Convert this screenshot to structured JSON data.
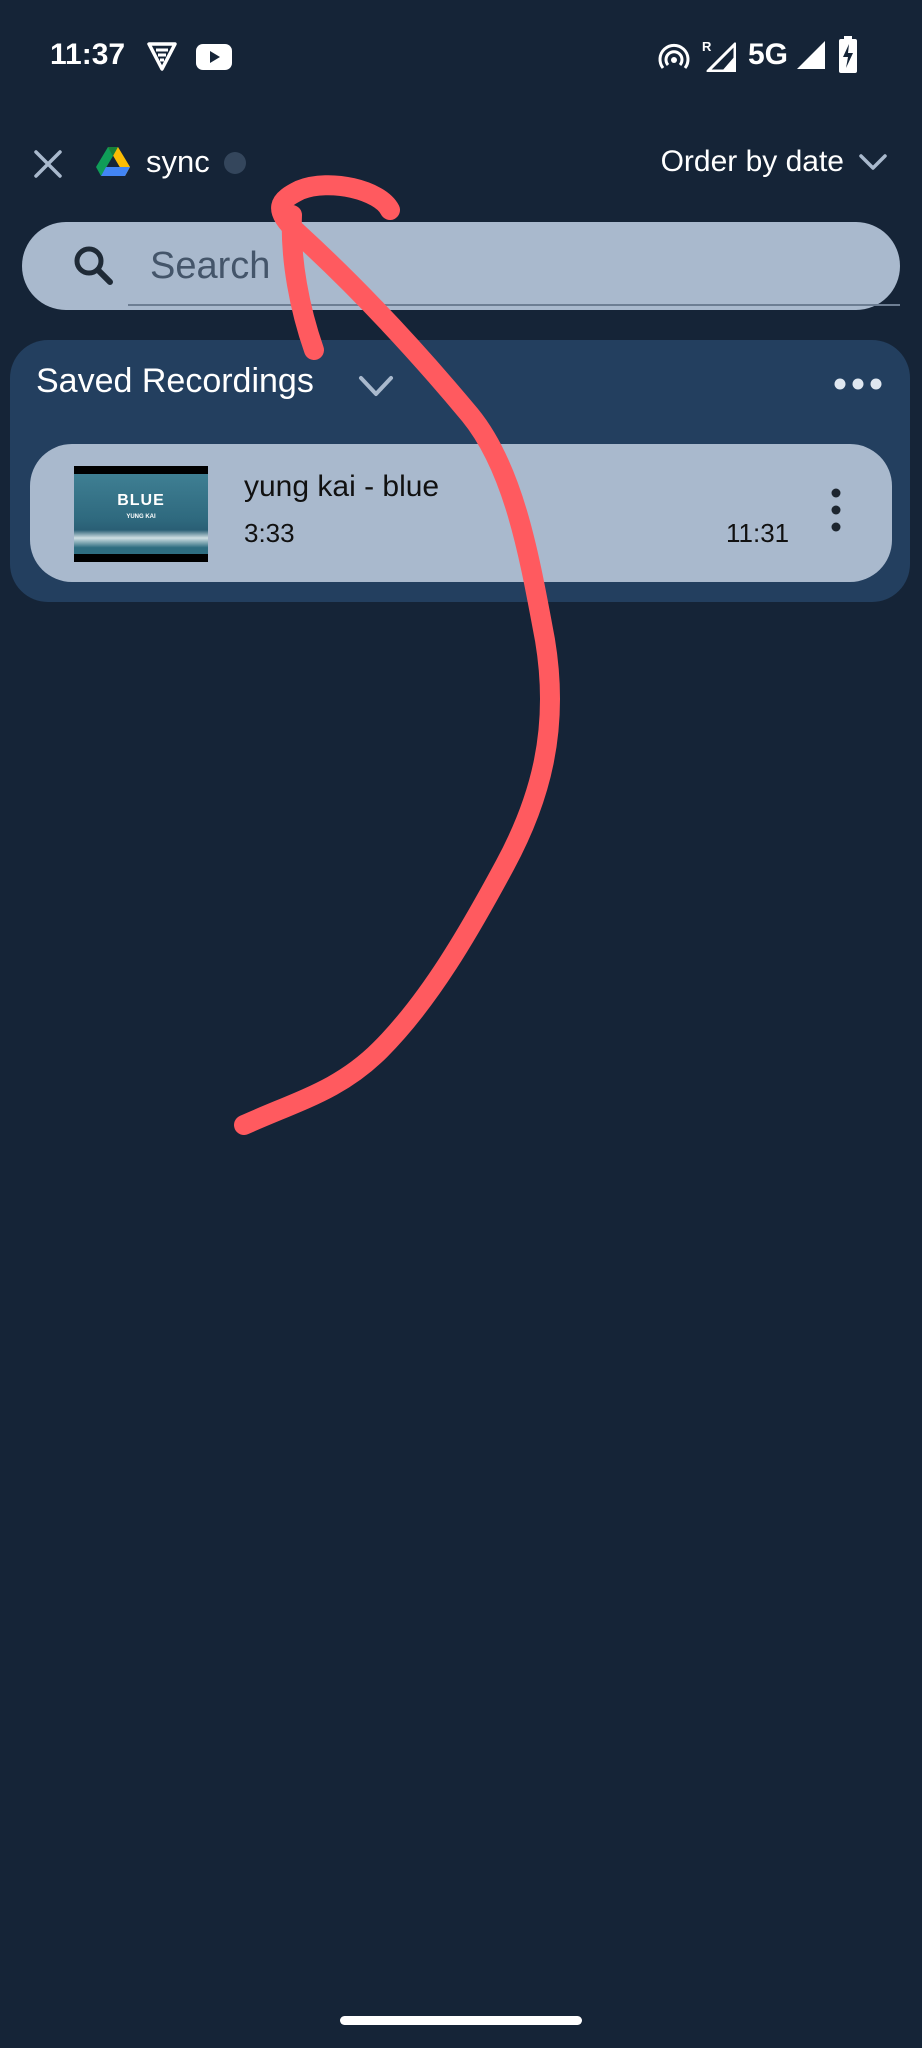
{
  "status_bar": {
    "time": "11:37",
    "network": "5G",
    "icons": [
      "vpn-icon",
      "youtube-icon",
      "hotspot-icon",
      "roaming-signal-icon",
      "signal-icon",
      "battery-charging-icon"
    ]
  },
  "top_bar": {
    "source_label": "sync",
    "order_label": "Order by date",
    "icons": [
      "close-icon",
      "google-drive-icon",
      "chevron-down-icon"
    ]
  },
  "search": {
    "placeholder": "Search",
    "value": ""
  },
  "saved_recordings": {
    "title": "Saved Recordings",
    "items": [
      {
        "title": "yung kai - blue",
        "duration": "3:33",
        "time": "11:31",
        "thumbnail_title": "BLUE",
        "thumbnail_subtitle": "YUNG KAI"
      }
    ]
  },
  "colors": {
    "background": "#152437",
    "panel": "#233f5f",
    "card": "#a9b9cd",
    "annotation": "#ff5a5f"
  }
}
